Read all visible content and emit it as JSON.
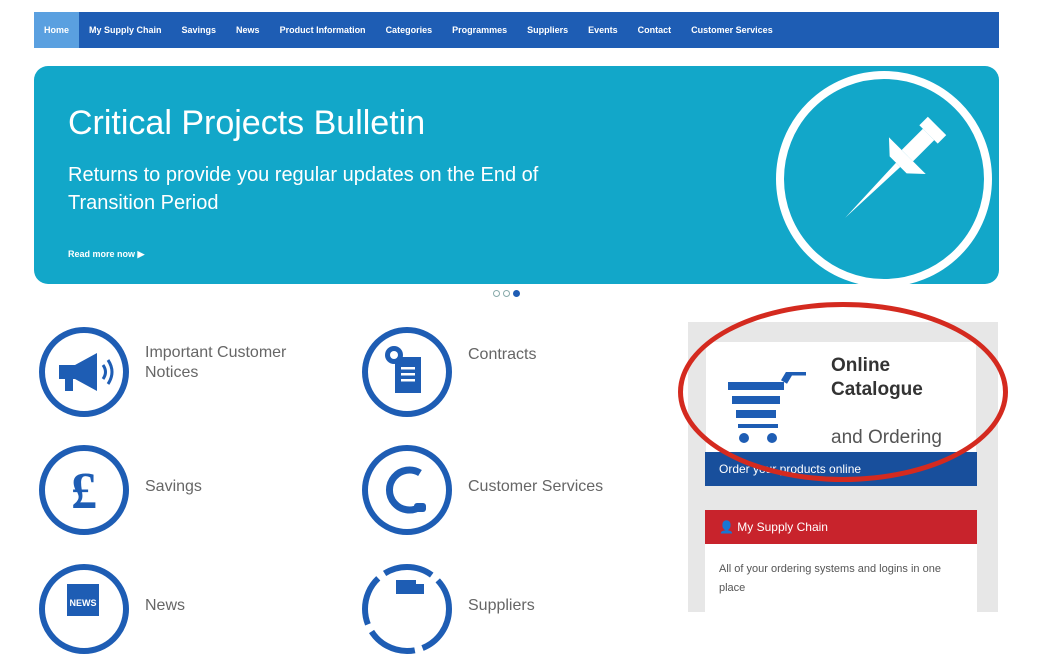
{
  "nav": {
    "items": [
      "Home",
      "My Supply Chain",
      "Savings",
      "News",
      "Product Information",
      "Categories",
      "Programmes",
      "Suppliers",
      "Events",
      "Contact",
      "Customer Services"
    ],
    "active_index": 0
  },
  "banner": {
    "title": "Critical Projects Bulletin",
    "subtitle": "Returns to provide you regular updates on the End of Transition Period",
    "read_more": "Read more now ▶",
    "icon": "push-pin-icon"
  },
  "carousel": {
    "count": 3,
    "active_index": 2
  },
  "tiles": {
    "notices": "Important Customer Notices",
    "contracts": "Contracts",
    "savings": "Savings",
    "customer_services": "Customer Services",
    "news": "News",
    "suppliers": "Suppliers"
  },
  "panel": {
    "catalogue_title": "Online Catalogue",
    "catalogue_sub": "and Ordering",
    "order_label": "Order your products online",
    "my_supply_chain_label": "👤 My Supply Chain",
    "my_supply_chain_desc": "All of your ordering systems and logins in one place"
  },
  "colors": {
    "nav": "#1e5db4",
    "banner": "#12a7c9",
    "icon_blue": "#1e5db4",
    "red": "#c8232c",
    "highlight": "#d42a1f"
  }
}
